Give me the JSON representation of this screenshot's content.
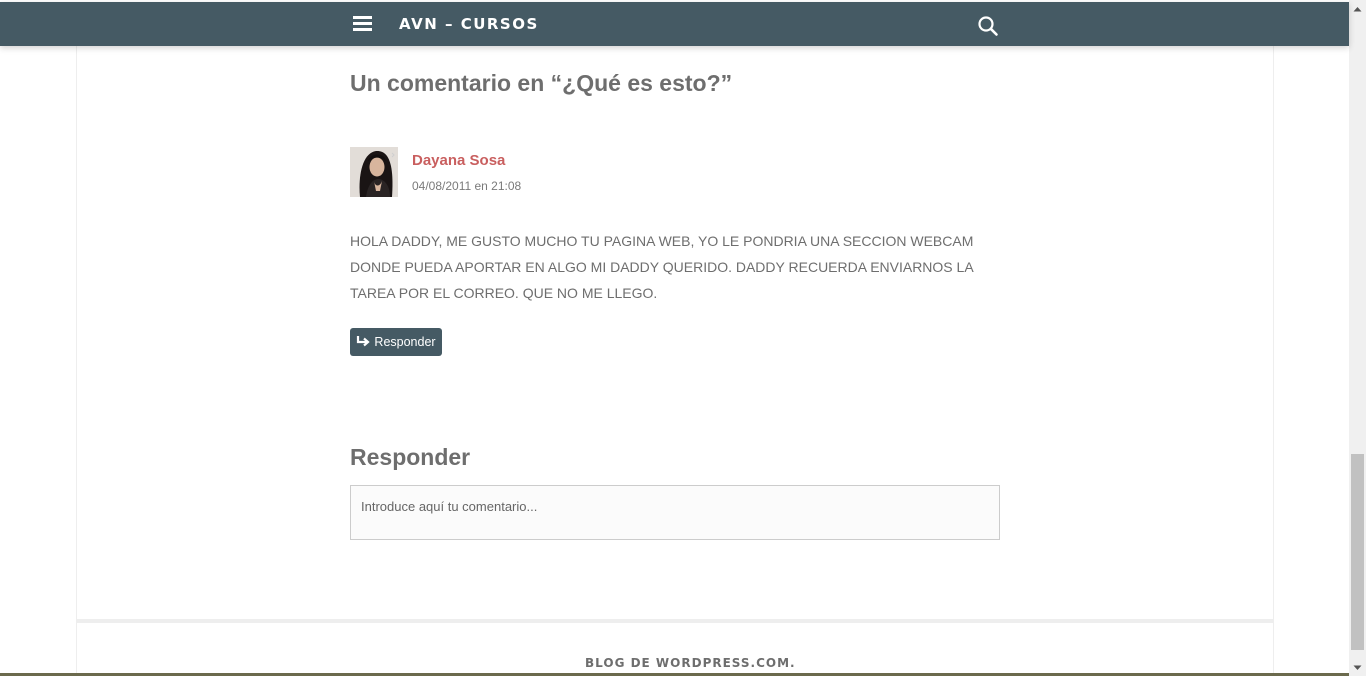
{
  "header": {
    "site_title": "AVN – CURSOS",
    "menu_icon": "hamburger-menu-icon",
    "search_icon": "search-icon",
    "bar_color": "#455a64"
  },
  "comments": {
    "title": "Un comentario en “¿Qué es esto?”",
    "items": [
      {
        "author": "Dayana Sosa",
        "date": "04/08/2011 en 21:08",
        "body": "HOLA DADDY, ME GUSTO MUCHO TU PAGINA WEB, YO LE PONDRIA UNA SECCION WEBCAM DONDE PUEDA APORTAR EN ALGO MI DADDY QUERIDO. DADDY RECUERDA ENVIARNOS LA TAREA POR EL CORREO. QUE NO ME LLEGO.",
        "reply_label": "Responder",
        "author_color": "#c95f5f"
      }
    ]
  },
  "reply_form": {
    "title": "Responder",
    "placeholder": "Introduce aquí tu comentario..."
  },
  "footer": {
    "link_text": "BLOG DE WORDPRESS.COM."
  }
}
